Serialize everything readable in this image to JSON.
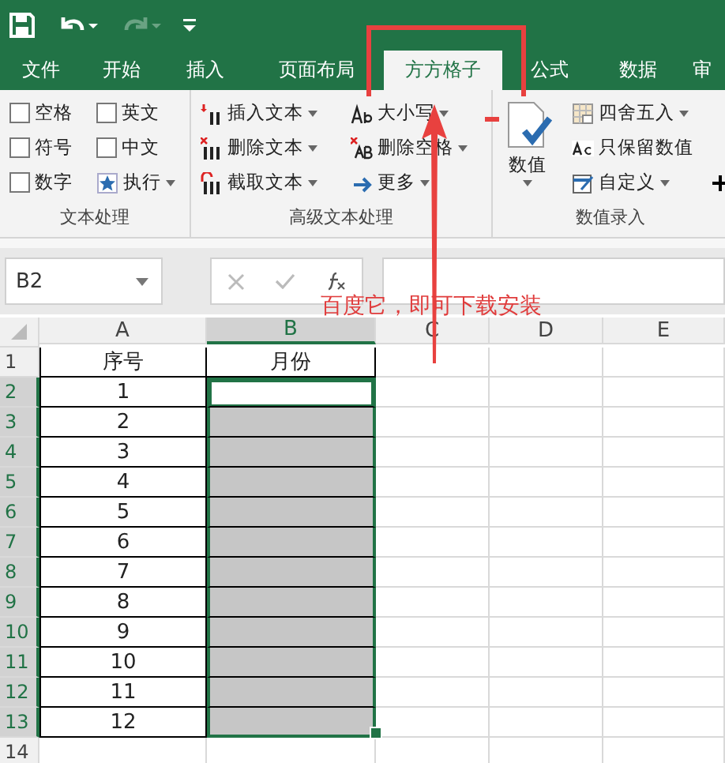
{
  "tabs": [
    {
      "label": "文件",
      "selected": false
    },
    {
      "label": "开始",
      "selected": false
    },
    {
      "label": "插入",
      "selected": false
    },
    {
      "label": "页面布局",
      "selected": false
    },
    {
      "label": "方方格子",
      "selected": true
    },
    {
      "label": "公式",
      "selected": false
    },
    {
      "label": "数据",
      "selected": false
    },
    {
      "label": "审",
      "selected": false
    }
  ],
  "ribbon_groups": [
    {
      "label": "文本处理",
      "items": [
        {
          "kind": "checkbox",
          "label": "空格",
          "checked": false
        },
        {
          "kind": "checkbox",
          "label": "符号",
          "checked": false
        },
        {
          "kind": "checkbox",
          "label": "数字",
          "checked": false
        },
        {
          "kind": "checkbox",
          "label": "英文",
          "checked": false
        },
        {
          "kind": "checkbox",
          "label": "中文",
          "checked": false
        },
        {
          "kind": "menu",
          "label": "执行"
        }
      ]
    },
    {
      "label": "高级文本处理",
      "items": [
        {
          "kind": "menu",
          "label": "插入文本"
        },
        {
          "kind": "menu",
          "label": "删除文本"
        },
        {
          "kind": "menu",
          "label": "截取文本"
        },
        {
          "kind": "menu",
          "label": "大小写"
        },
        {
          "kind": "menu",
          "label": "删除空格"
        },
        {
          "kind": "menu",
          "label": "更多"
        }
      ]
    },
    {
      "label": "数值录入",
      "items": [
        {
          "kind": "large",
          "label": "数值"
        },
        {
          "kind": "menu",
          "label": "四舍五入"
        },
        {
          "kind": "button",
          "label": "只保留数值"
        },
        {
          "kind": "menu",
          "label": "自定义"
        },
        {
          "kind": "plus"
        }
      ]
    }
  ],
  "formula_bar": {
    "name_box": "B2"
  },
  "sheet": {
    "columns": [
      {
        "label": "A",
        "selected": false
      },
      {
        "label": "B",
        "selected": true
      },
      {
        "label": "C",
        "selected": false
      },
      {
        "label": "D",
        "selected": false
      },
      {
        "label": "E",
        "selected": false
      }
    ],
    "rows": [
      {
        "header": "1",
        "selected": false,
        "active": false,
        "cells": [
          "序号",
          "月份"
        ]
      },
      {
        "header": "2",
        "selected": true,
        "active": true,
        "cells": [
          "1",
          ""
        ]
      },
      {
        "header": "3",
        "selected": true,
        "active": false,
        "cells": [
          "2",
          ""
        ]
      },
      {
        "header": "4",
        "selected": true,
        "active": false,
        "cells": [
          "3",
          ""
        ]
      },
      {
        "header": "5",
        "selected": true,
        "active": false,
        "cells": [
          "4",
          ""
        ]
      },
      {
        "header": "6",
        "selected": true,
        "active": false,
        "cells": [
          "5",
          ""
        ]
      },
      {
        "header": "7",
        "selected": true,
        "active": false,
        "cells": [
          "6",
          ""
        ]
      },
      {
        "header": "8",
        "selected": true,
        "active": false,
        "cells": [
          "7",
          ""
        ]
      },
      {
        "header": "9",
        "selected": true,
        "active": false,
        "cells": [
          "8",
          ""
        ]
      },
      {
        "header": "10",
        "selected": true,
        "active": false,
        "cells": [
          "9",
          ""
        ]
      },
      {
        "header": "11",
        "selected": true,
        "active": false,
        "cells": [
          "10",
          ""
        ]
      },
      {
        "header": "12",
        "selected": true,
        "active": false,
        "cells": [
          "11",
          ""
        ]
      },
      {
        "header": "13",
        "selected": true,
        "active": false,
        "cells": [
          "12",
          ""
        ]
      },
      {
        "header": "14",
        "selected": false,
        "active": false,
        "cells": [
          "",
          ""
        ]
      }
    ]
  },
  "annotation": {
    "text": "百度它，即可下载安装"
  }
}
